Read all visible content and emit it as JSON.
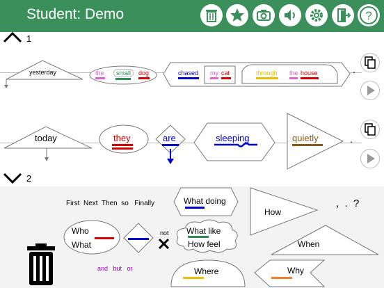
{
  "header": {
    "title": "Student: Demo",
    "accent": "#3a8f5b",
    "icons": [
      "trash-icon",
      "star-icon",
      "camera-icon",
      "speaker-icon",
      "gear-icon",
      "exit-icon",
      "help-icon"
    ]
  },
  "section1": {
    "number": "1",
    "when": "yesterday",
    "noun_phrase": {
      "det": "the",
      "adj": "small",
      "noun": "dog"
    },
    "verb": "chased",
    "object": {
      "pron": "my",
      "noun": "cat"
    },
    "prep_phrase": {
      "prep": "through",
      "det": "the",
      "noun": "house"
    },
    "end": "."
  },
  "section2": {
    "when": "today",
    "who": "they",
    "aux": "are",
    "verb": "sleeping",
    "adverb": "quietly",
    "end": "."
  },
  "palette": {
    "number": "2",
    "connectors": "First  Next  Then  so   Finally",
    "who_what_1": "Who",
    "who_what_2": "What",
    "not": "not",
    "what_doing": "What doing",
    "what_like": "What like",
    "how_feel": "How feel",
    "how": "How",
    "punct": ",  .  ?",
    "when": "When",
    "and_but_or": "and   but   or",
    "where": "Where",
    "why": "Why"
  },
  "colors": {
    "pink": "#e060d0",
    "green": "#2e8b57",
    "red": "#d40000",
    "blue": "#0000cc",
    "yellow": "#e8c000",
    "brown": "#8b5a1a",
    "orange": "#f08030",
    "purple": "#9900cc"
  }
}
